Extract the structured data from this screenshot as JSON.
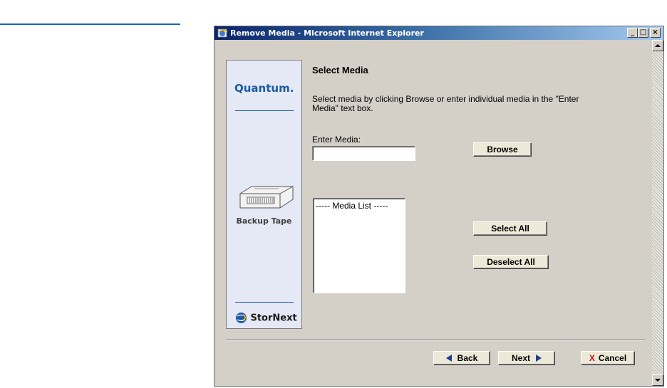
{
  "window": {
    "title": "Remove Media - Microsoft Internet Explorer",
    "minimize": "_",
    "maximize": "□",
    "close": "×"
  },
  "side_panel": {
    "brand": "Quantum.",
    "section_label": "Backup Tape",
    "product": "StorNext"
  },
  "main": {
    "heading": "Select Media",
    "instructions": "Select media by clicking Browse or enter individual media in the \"Enter Media\" text box.",
    "enter_media_label": "Enter Media:",
    "enter_media_value": "",
    "browse_label": "Browse",
    "media_list_header": "----- Media List -----",
    "select_all_label": "Select All",
    "deselect_all_label": "Deselect All"
  },
  "footer": {
    "back_label": "Back",
    "next_label": "Next",
    "cancel_label": "Cancel",
    "cancel_mark": "X"
  },
  "colors": {
    "brand_blue": "#1b5aa8",
    "nav_arrow": "#1e3e8c",
    "cancel_red": "#cc1111"
  }
}
